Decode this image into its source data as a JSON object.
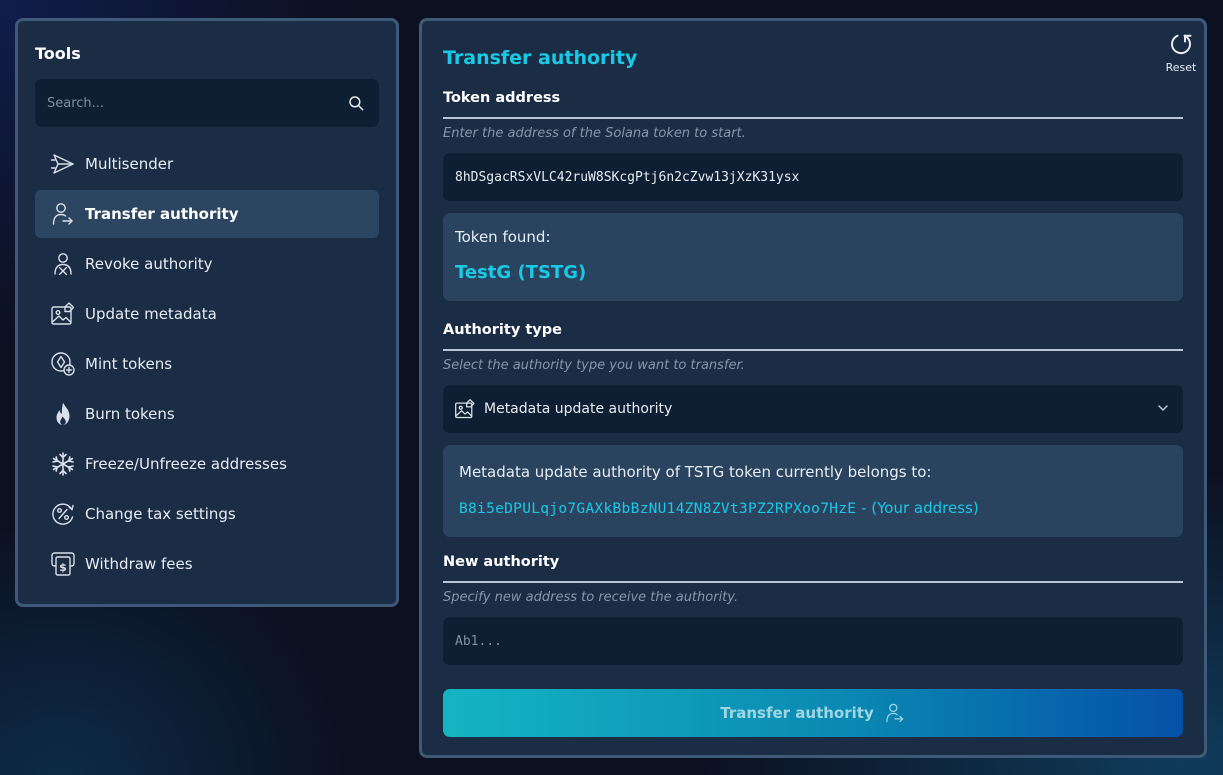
{
  "sidebar": {
    "title": "Tools",
    "search_placeholder": "Search...",
    "items": [
      {
        "label": "Multisender",
        "icon": "paper-plane-icon",
        "active": false
      },
      {
        "label": "Transfer authority",
        "icon": "user-transfer-icon",
        "active": true
      },
      {
        "label": "Revoke authority",
        "icon": "user-revoke-icon",
        "active": false
      },
      {
        "label": "Update metadata",
        "icon": "image-edit-icon",
        "active": false
      },
      {
        "label": "Mint tokens",
        "icon": "coin-plus-icon",
        "active": false
      },
      {
        "label": "Burn tokens",
        "icon": "flame-icon",
        "active": false
      },
      {
        "label": "Freeze/Unfreeze addresses",
        "icon": "snowflake-icon",
        "active": false
      },
      {
        "label": "Change tax settings",
        "icon": "percent-icon",
        "active": false
      },
      {
        "label": "Withdraw fees",
        "icon": "dollar-withdraw-icon",
        "active": false
      }
    ]
  },
  "main": {
    "title": "Transfer authority",
    "reset_label": "Reset",
    "token_address": {
      "label": "Token address",
      "hint": "Enter the address of the Solana token to start.",
      "value": "8hDSgacRSxVLC42ruW8SKcgPtj6n2cZvw13jXzK31ysx"
    },
    "token_found": {
      "label": "Token found:",
      "name": "TestG (TSTG)"
    },
    "authority_type": {
      "label": "Authority type",
      "hint": "Select the authority type you want to transfer.",
      "selected": "Metadata update authority"
    },
    "authority_belongs": {
      "text": "Metadata update authority of TSTG token currently belongs to:",
      "address": "B8i5eDPULqjo7GAXkBbBzNU14ZN8ZVt3PZ2RPXoo7HzE",
      "suffix": " - (Your address)"
    },
    "new_authority": {
      "label": "New authority",
      "hint": "Specify new address to receive the authority.",
      "placeholder": "Ab1..."
    },
    "submit_label": "Transfer authority"
  },
  "colors": {
    "accent": "#19c9e6",
    "panel": "#1a2d45",
    "field": "#0e1f33",
    "active_item": "#2c4561",
    "info_box": "#2a4460"
  }
}
